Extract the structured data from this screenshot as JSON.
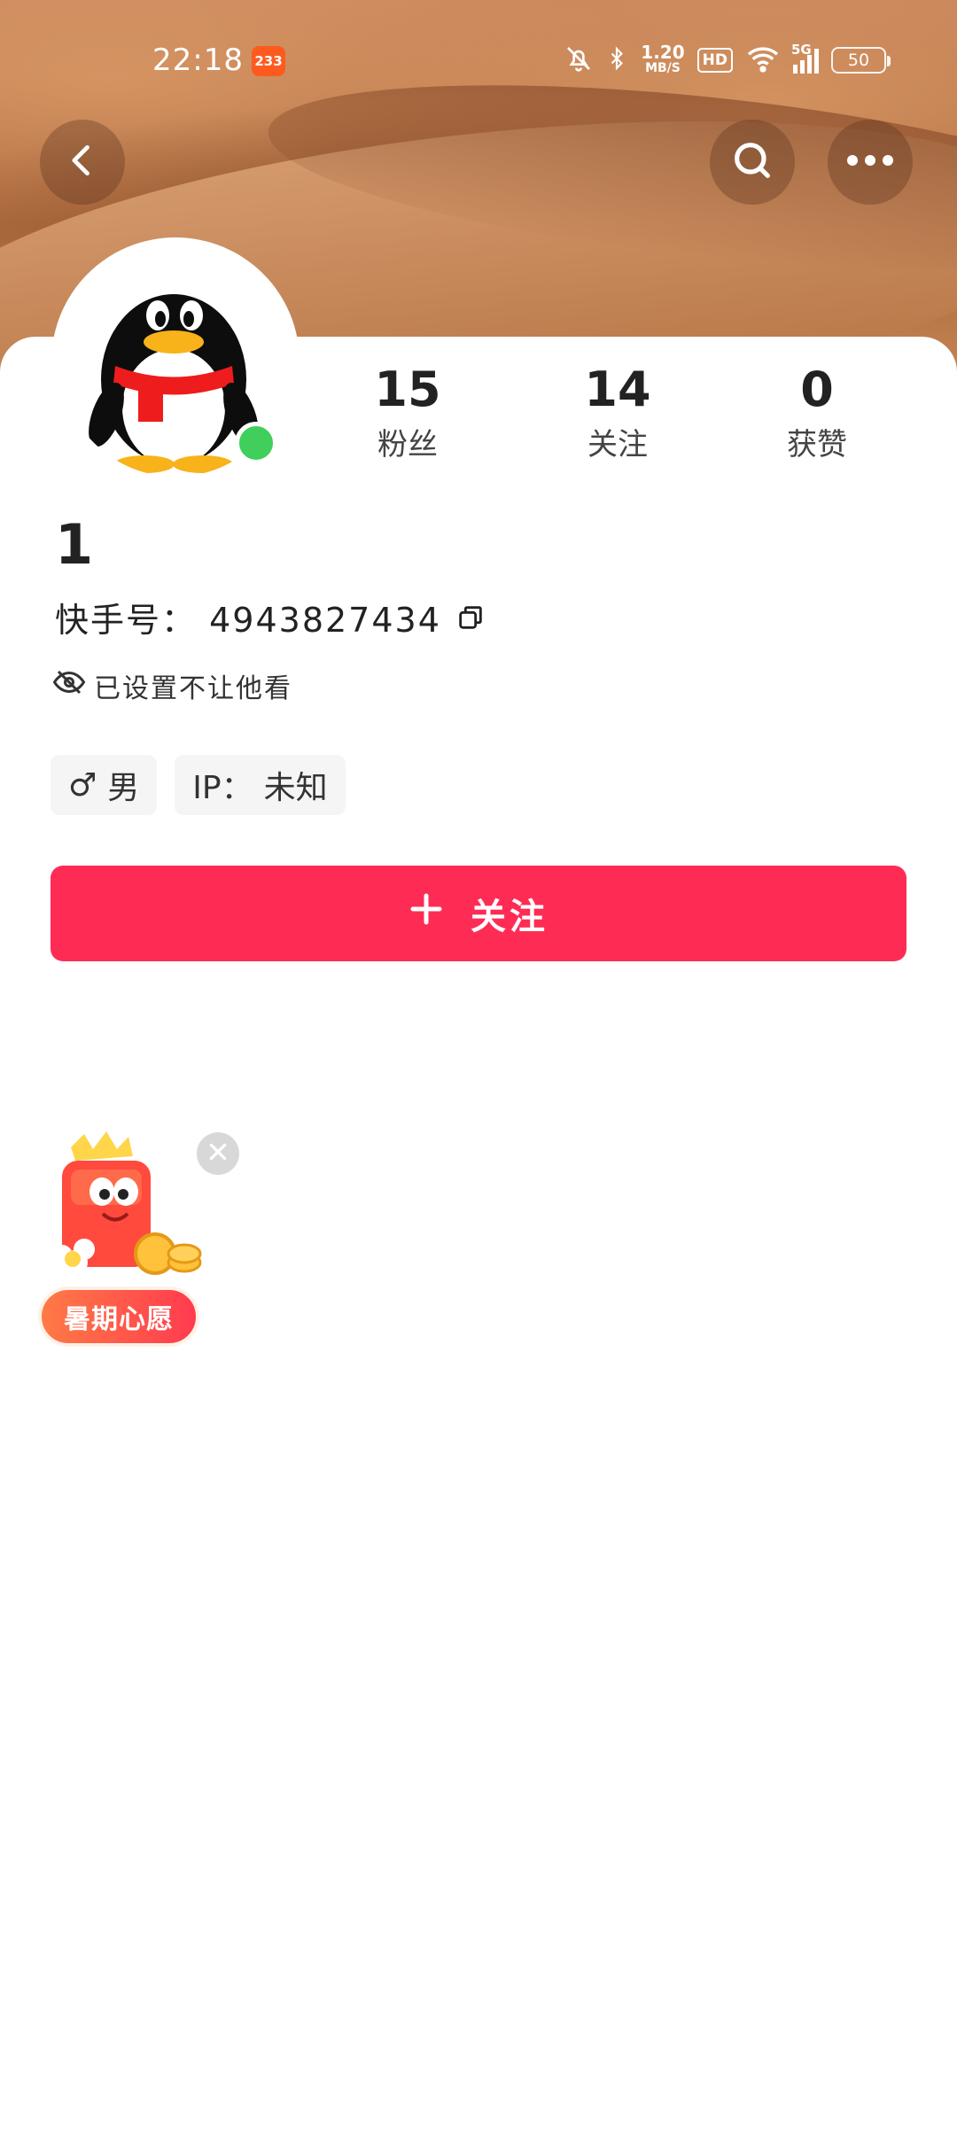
{
  "status_bar": {
    "time": "22:18",
    "app_badge": "233",
    "net_speed_value": "1.20",
    "net_speed_unit": "MB/S",
    "hd_label": "HD",
    "signal_label": "5G",
    "battery": "50"
  },
  "header": {
    "back_icon": "chevron-left-icon",
    "search_icon": "search-icon",
    "more_icon": "more-dots-icon"
  },
  "stats": {
    "fans_count": "15",
    "fans_label": "粉丝",
    "following_count": "14",
    "following_label": "关注",
    "likes_count": "0",
    "likes_label": "获赞"
  },
  "profile": {
    "name": "1",
    "kuaishou_id_label": "快手号：",
    "kuaishou_id": "4943827434",
    "privacy_text": "已设置不让他看",
    "gender_symbol": "♂",
    "gender": "男",
    "ip_label": "IP：",
    "ip_value": "未知"
  },
  "actions": {
    "follow_label": "关注"
  },
  "widget": {
    "label": "暑期心愿"
  },
  "colors": {
    "accent": "#fe2c55",
    "online": "#3fcf5a"
  }
}
